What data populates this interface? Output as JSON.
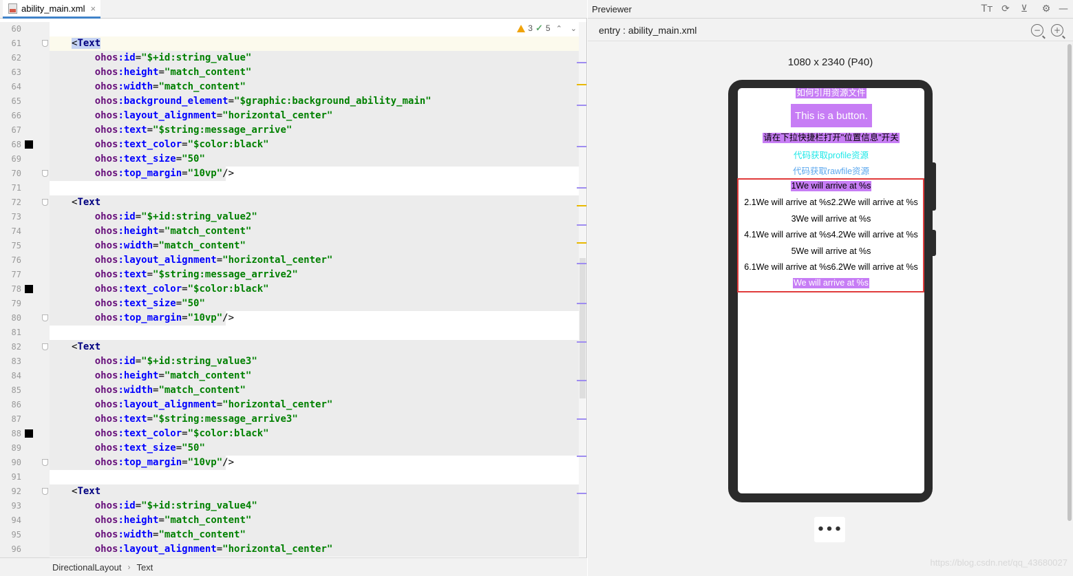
{
  "editor": {
    "tab": {
      "label": "ability_main.xml",
      "close": "×",
      "icon": "xml-file-icon"
    },
    "inspection": {
      "warnings": "3",
      "ok": "5",
      "up": "⌃",
      "down": "⌄"
    },
    "lines": [
      {
        "n": "60",
        "tokens": []
      },
      {
        "n": "61",
        "tokens": [
          [
            "tag-hl tk-bracket",
            "<"
          ],
          [
            "tag-hl tk-tag",
            "Text"
          ]
        ]
      },
      {
        "n": "62",
        "tokens": [
          [
            "tk-ns",
            "    ohos"
          ],
          [
            "tk-attr",
            ":id"
          ],
          [
            "tk-eq",
            "="
          ],
          [
            "tk-val",
            "\"$+id:string_value\""
          ]
        ]
      },
      {
        "n": "63",
        "tokens": [
          [
            "tk-ns",
            "    ohos"
          ],
          [
            "tk-attr",
            ":height"
          ],
          [
            "tk-eq",
            "="
          ],
          [
            "tk-val",
            "\"match_content\""
          ]
        ]
      },
      {
        "n": "64",
        "tokens": [
          [
            "tk-ns",
            "    ohos"
          ],
          [
            "tk-attr",
            ":width"
          ],
          [
            "tk-eq",
            "="
          ],
          [
            "tk-val",
            "\"match_content\""
          ]
        ]
      },
      {
        "n": "65",
        "tokens": [
          [
            "tk-ns",
            "    ohos"
          ],
          [
            "tk-attr",
            ":background_element"
          ],
          [
            "tk-eq",
            "="
          ],
          [
            "tk-val",
            "\"$graphic:background_ability_main\""
          ]
        ]
      },
      {
        "n": "66",
        "tokens": [
          [
            "tk-ns",
            "    ohos"
          ],
          [
            "tk-attr",
            ":layout_alignment"
          ],
          [
            "tk-eq",
            "="
          ],
          [
            "tk-val",
            "\"horizontal_center\""
          ]
        ]
      },
      {
        "n": "67",
        "tokens": [
          [
            "tk-ns",
            "    ohos"
          ],
          [
            "tk-attr",
            ":text"
          ],
          [
            "tk-eq",
            "="
          ],
          [
            "tk-val",
            "\"$string:message_arrive\""
          ]
        ]
      },
      {
        "n": "68",
        "tokens": [
          [
            "tk-ns",
            "    ohos"
          ],
          [
            "tk-attr",
            ":text_color"
          ],
          [
            "tk-eq",
            "="
          ],
          [
            "tk-val",
            "\"$color:black\""
          ]
        ]
      },
      {
        "n": "69",
        "tokens": [
          [
            "tk-ns",
            "    ohos"
          ],
          [
            "tk-attr",
            ":text_size"
          ],
          [
            "tk-eq",
            "="
          ],
          [
            "tk-val",
            "\"50\""
          ]
        ]
      },
      {
        "n": "70",
        "tokens": [
          [
            "tk-ns",
            "    ohos"
          ],
          [
            "tk-attr",
            ":top_margin"
          ],
          [
            "tk-eq",
            "="
          ],
          [
            "tk-val",
            "\"10vp\""
          ],
          [
            "tk-bracket",
            "/>"
          ]
        ]
      },
      {
        "n": "71",
        "tokens": []
      },
      {
        "n": "72",
        "tokens": [
          [
            "tk-bracket",
            "<"
          ],
          [
            "tk-tag",
            "Text"
          ]
        ]
      },
      {
        "n": "73",
        "tokens": [
          [
            "tk-ns",
            "    ohos"
          ],
          [
            "tk-attr",
            ":id"
          ],
          [
            "tk-eq",
            "="
          ],
          [
            "tk-val",
            "\"$+id:string_value2\""
          ]
        ]
      },
      {
        "n": "74",
        "tokens": [
          [
            "tk-ns",
            "    ohos"
          ],
          [
            "tk-attr",
            ":height"
          ],
          [
            "tk-eq",
            "="
          ],
          [
            "tk-val",
            "\"match_content\""
          ]
        ]
      },
      {
        "n": "75",
        "tokens": [
          [
            "tk-ns",
            "    ohos"
          ],
          [
            "tk-attr",
            ":width"
          ],
          [
            "tk-eq",
            "="
          ],
          [
            "tk-val",
            "\"match_content\""
          ]
        ]
      },
      {
        "n": "76",
        "tokens": [
          [
            "tk-ns",
            "    ohos"
          ],
          [
            "tk-attr",
            ":layout_alignment"
          ],
          [
            "tk-eq",
            "="
          ],
          [
            "tk-val",
            "\"horizontal_center\""
          ]
        ]
      },
      {
        "n": "77",
        "tokens": [
          [
            "tk-ns",
            "    ohos"
          ],
          [
            "tk-attr",
            ":text"
          ],
          [
            "tk-eq",
            "="
          ],
          [
            "tk-val",
            "\"$string:message_arrive2\""
          ]
        ]
      },
      {
        "n": "78",
        "tokens": [
          [
            "tk-ns",
            "    ohos"
          ],
          [
            "tk-attr",
            ":text_color"
          ],
          [
            "tk-eq",
            "="
          ],
          [
            "tk-val",
            "\"$color:black\""
          ]
        ]
      },
      {
        "n": "79",
        "tokens": [
          [
            "tk-ns",
            "    ohos"
          ],
          [
            "tk-attr",
            ":text_size"
          ],
          [
            "tk-eq",
            "="
          ],
          [
            "tk-val",
            "\"50\""
          ]
        ]
      },
      {
        "n": "80",
        "tokens": [
          [
            "tk-ns",
            "    ohos"
          ],
          [
            "tk-attr",
            ":top_margin"
          ],
          [
            "tk-eq",
            "="
          ],
          [
            "tk-val",
            "\"10vp\""
          ],
          [
            "tk-bracket",
            "/>"
          ]
        ]
      },
      {
        "n": "81",
        "tokens": []
      },
      {
        "n": "82",
        "tokens": [
          [
            "tk-bracket",
            "<"
          ],
          [
            "tk-tag",
            "Text"
          ]
        ]
      },
      {
        "n": "83",
        "tokens": [
          [
            "tk-ns",
            "    ohos"
          ],
          [
            "tk-attr",
            ":id"
          ],
          [
            "tk-eq",
            "="
          ],
          [
            "tk-val",
            "\"$+id:string_value3\""
          ]
        ]
      },
      {
        "n": "84",
        "tokens": [
          [
            "tk-ns",
            "    ohos"
          ],
          [
            "tk-attr",
            ":height"
          ],
          [
            "tk-eq",
            "="
          ],
          [
            "tk-val",
            "\"match_content\""
          ]
        ]
      },
      {
        "n": "85",
        "tokens": [
          [
            "tk-ns",
            "    ohos"
          ],
          [
            "tk-attr",
            ":width"
          ],
          [
            "tk-eq",
            "="
          ],
          [
            "tk-val",
            "\"match_content\""
          ]
        ]
      },
      {
        "n": "86",
        "tokens": [
          [
            "tk-ns",
            "    ohos"
          ],
          [
            "tk-attr",
            ":layout_alignment"
          ],
          [
            "tk-eq",
            "="
          ],
          [
            "tk-val",
            "\"horizontal_center\""
          ]
        ]
      },
      {
        "n": "87",
        "tokens": [
          [
            "tk-ns",
            "    ohos"
          ],
          [
            "tk-attr",
            ":text"
          ],
          [
            "tk-eq",
            "="
          ],
          [
            "tk-val",
            "\"$string:message_arrive3\""
          ]
        ]
      },
      {
        "n": "88",
        "tokens": [
          [
            "tk-ns",
            "    ohos"
          ],
          [
            "tk-attr",
            ":text_color"
          ],
          [
            "tk-eq",
            "="
          ],
          [
            "tk-val",
            "\"$color:black\""
          ]
        ]
      },
      {
        "n": "89",
        "tokens": [
          [
            "tk-ns",
            "    ohos"
          ],
          [
            "tk-attr",
            ":text_size"
          ],
          [
            "tk-eq",
            "="
          ],
          [
            "tk-val",
            "\"50\""
          ]
        ]
      },
      {
        "n": "90",
        "tokens": [
          [
            "tk-ns",
            "    ohos"
          ],
          [
            "tk-attr",
            ":top_margin"
          ],
          [
            "tk-eq",
            "="
          ],
          [
            "tk-val",
            "\"10vp\""
          ],
          [
            "tk-bracket",
            "/>"
          ]
        ]
      },
      {
        "n": "91",
        "tokens": []
      },
      {
        "n": "92",
        "tokens": [
          [
            "tk-bracket",
            "<"
          ],
          [
            "tk-tag",
            "Text"
          ]
        ]
      },
      {
        "n": "93",
        "tokens": [
          [
            "tk-ns",
            "    ohos"
          ],
          [
            "tk-attr",
            ":id"
          ],
          [
            "tk-eq",
            "="
          ],
          [
            "tk-val",
            "\"$+id:string_value4\""
          ]
        ]
      },
      {
        "n": "94",
        "tokens": [
          [
            "tk-ns",
            "    ohos"
          ],
          [
            "tk-attr",
            ":height"
          ],
          [
            "tk-eq",
            "="
          ],
          [
            "tk-val",
            "\"match_content\""
          ]
        ]
      },
      {
        "n": "95",
        "tokens": [
          [
            "tk-ns",
            "    ohos"
          ],
          [
            "tk-attr",
            ":width"
          ],
          [
            "tk-eq",
            "="
          ],
          [
            "tk-val",
            "\"match_content\""
          ]
        ]
      },
      {
        "n": "96",
        "tokens": [
          [
            "tk-ns",
            "    ohos"
          ],
          [
            "tk-attr",
            ":layout_alignment"
          ],
          [
            "tk-eq",
            "="
          ],
          [
            "tk-val",
            "\"horizontal_center\""
          ]
        ]
      }
    ],
    "breadcrumb": {
      "items": [
        "DirectionalLayout",
        "Text"
      ],
      "separator": "›"
    }
  },
  "previewer": {
    "title": "Previewer",
    "entry": "entry : ability_main.xml",
    "device_label": "1080 x 2340 (P40)",
    "toolbar_icons": [
      "text-size-icon",
      "refresh-icon",
      "pin-icon",
      "settings-icon"
    ],
    "more": "•••",
    "app": {
      "title": "如何引用资源文件",
      "button": "This is a button.",
      "location_text": "请在下拉快捷栏打开\"位置信息\"开关",
      "profile_text": "代码获取profile资源",
      "rawfile_text": "代码获取rawfile资源",
      "arrive_lines": [
        "1We will arrive at %s",
        "2.1We will arrive at %s2.2We will arrive at %s",
        "3We will arrive at %s",
        "4.1We will arrive at %s4.2We will arrive at %s",
        "5We will arrive at %s",
        "6.1We will arrive at %s6.2We will arrive at %s",
        "We will arrive at %s"
      ]
    }
  },
  "watermark": "https://blog.csdn.net/qq_43680027",
  "colors": {
    "accent_purple": "#c77df5",
    "cyan_text": "#1ee8e8",
    "blue_text": "#5aa7ee",
    "highlight_red": "#e03a3a",
    "xml_value_green": "#008000",
    "xml_attr_blue": "#0000ff"
  }
}
